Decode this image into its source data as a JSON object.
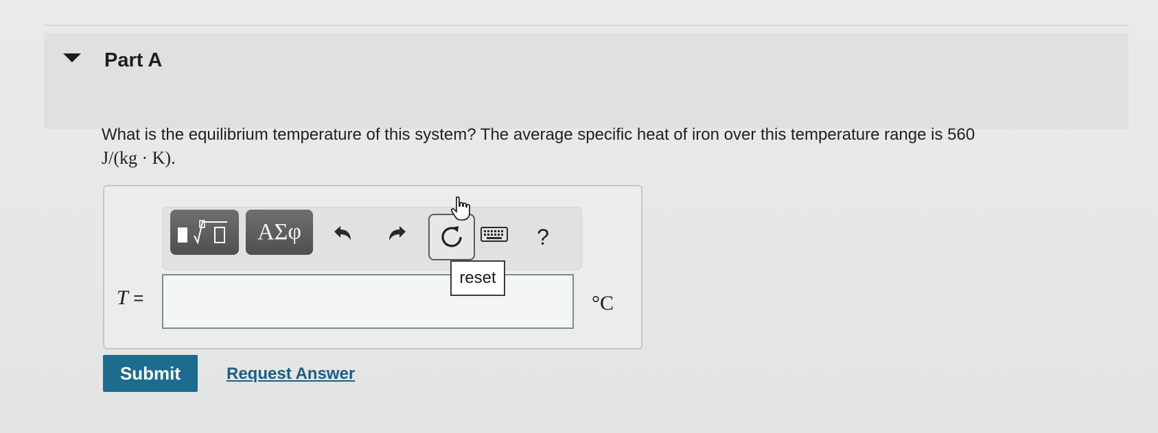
{
  "part": {
    "title": "Part A",
    "collapse_icon": "caret-down-icon"
  },
  "question": {
    "text": "What is the equilibrium temperature of this system? The average specific heat of iron over this temperature range is 560",
    "units": "J/(kg · K)."
  },
  "toolbar": {
    "templates_icon": "templates-root-icon",
    "greek_label": "ΑΣφ",
    "undo_icon": "undo-icon",
    "redo_icon": "redo-icon",
    "reset_icon": "reset-icon",
    "keyboard_icon": "keyboard-icon",
    "help_label": "?"
  },
  "tooltip": {
    "text": "reset"
  },
  "answer": {
    "variable": "T",
    "equals": "=",
    "value": "",
    "placeholder": "",
    "unit": "°C"
  },
  "actions": {
    "submit_label": "Submit",
    "request_answer_label": "Request Answer"
  },
  "colors": {
    "submit_bg": "#1d6b8e",
    "link": "#1d5e83",
    "toolbar_dark": "#5a5a5a"
  }
}
